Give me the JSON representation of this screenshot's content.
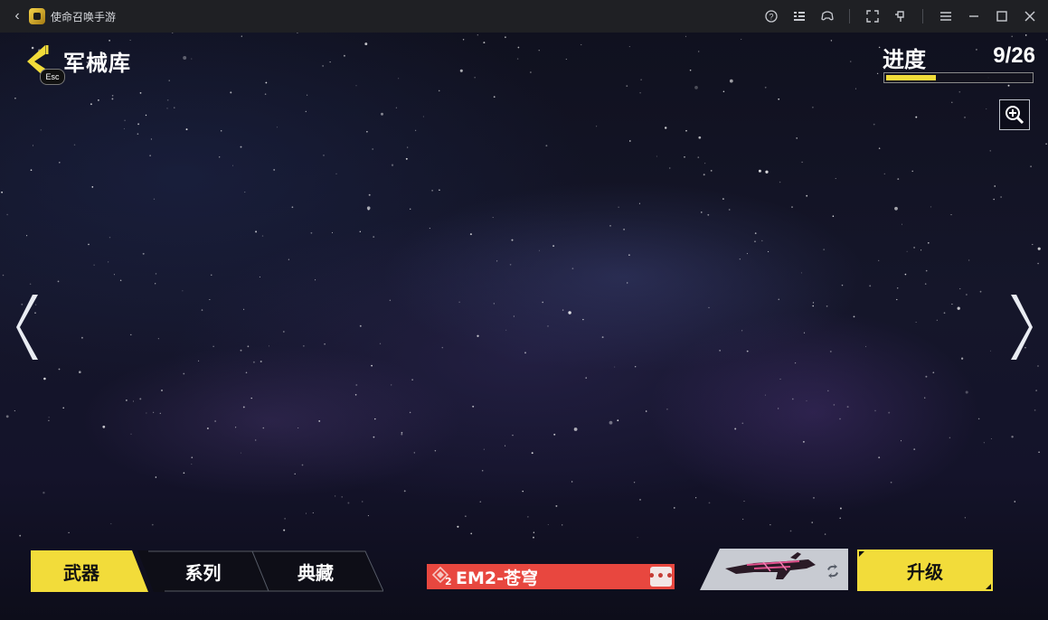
{
  "window": {
    "title": "使命召唤手游"
  },
  "header": {
    "page_title": "军械库",
    "esc_label": "Esc"
  },
  "progress": {
    "label": "进度",
    "count_text": "9/26",
    "current": 9,
    "total": 26,
    "fill_color": "#f2dc3a"
  },
  "tabs": [
    {
      "label": "武器",
      "active": true
    },
    {
      "label": "系列",
      "active": false
    },
    {
      "label": "典藏",
      "active": false
    }
  ],
  "weapon": {
    "name": "EM2-苍穹",
    "tier_badge": "2",
    "more_label": "•••",
    "bar_color": "#e8473f"
  },
  "upgrade": {
    "label": "升级",
    "color": "#f2dc3a"
  },
  "icons": {
    "back": "back-arrow-icon",
    "zoom": "zoom-in-icon",
    "prev": "chevron-left-icon",
    "next": "chevron-right-icon",
    "swap": "swap-icon"
  }
}
